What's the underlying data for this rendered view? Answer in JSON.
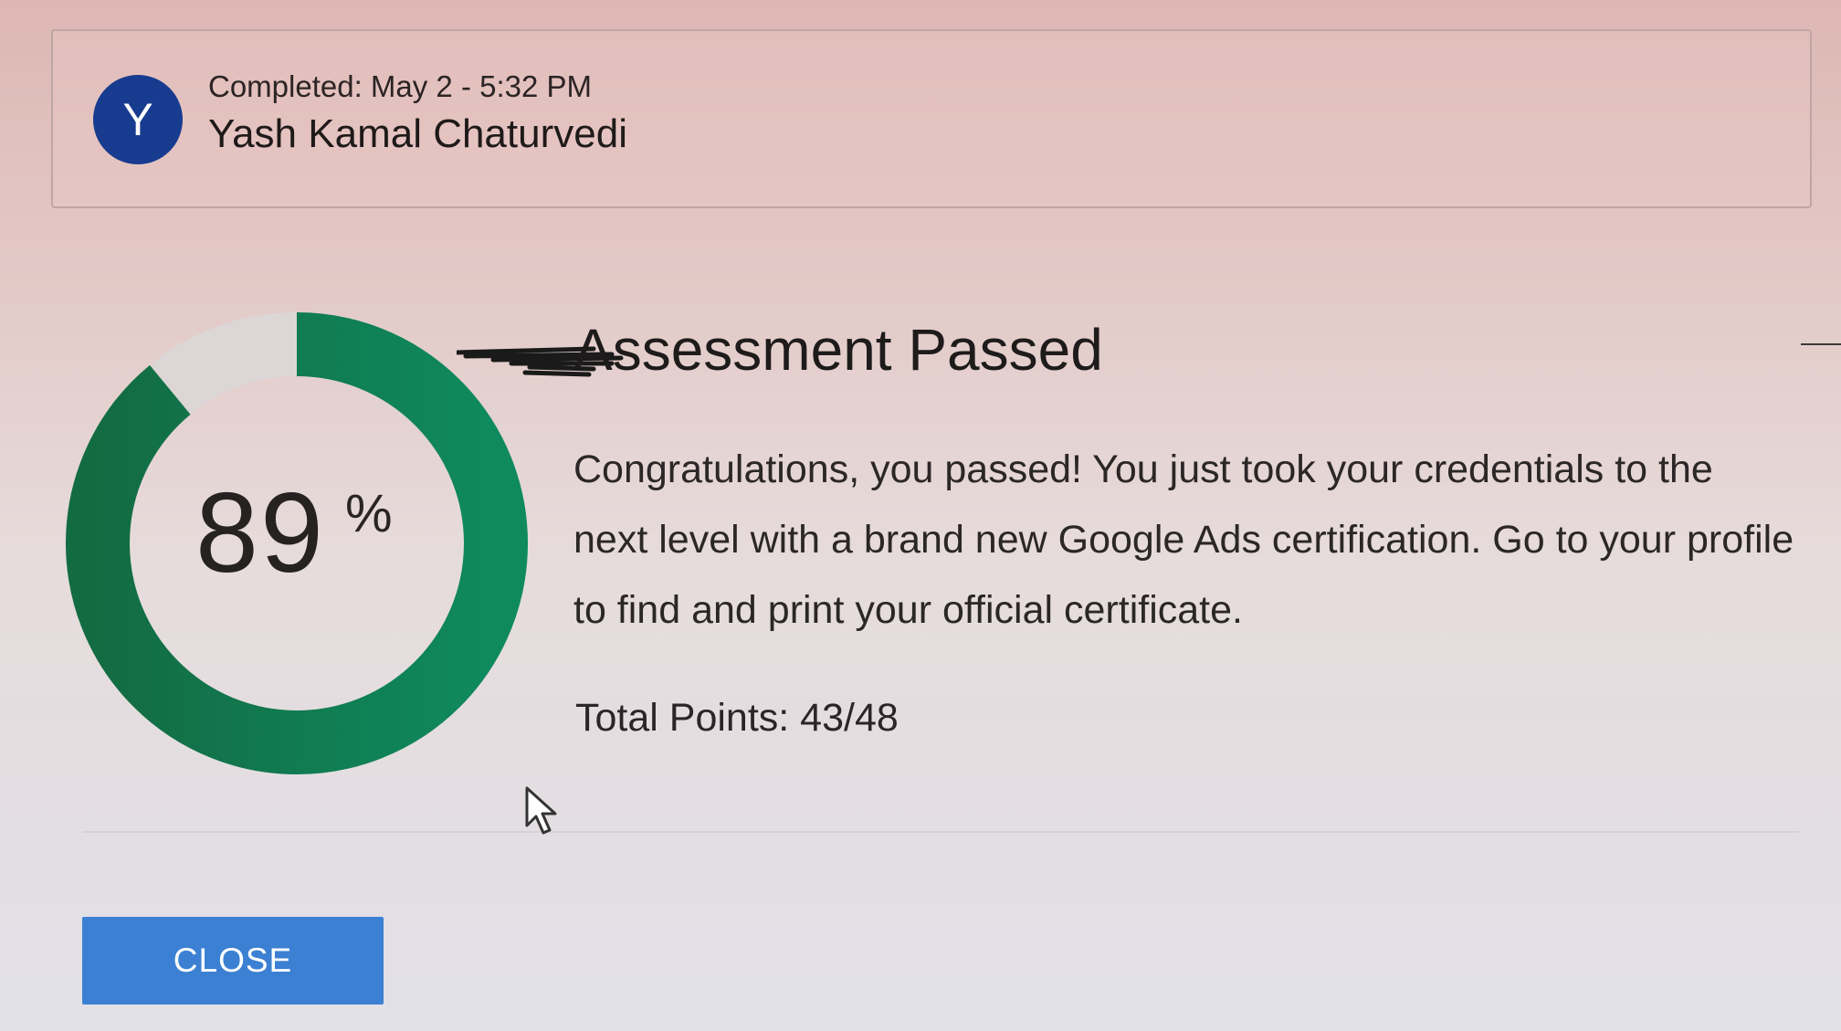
{
  "user": {
    "avatar_letter": "Y",
    "completed": "Completed: May 2 - 5:32 PM",
    "name": "Yash Kamal Chaturvedi"
  },
  "result": {
    "score": "89",
    "score_unit": "%",
    "score_fraction": 0.89,
    "title": "Assessment Passed",
    "message": "Congratulations, you passed! You just took your credentials to the next level with a brand new Google Ads certification. Go to your profile to find and print your official certificate.",
    "total_points": "Total Points: 43/48"
  },
  "actions": {
    "close_label": "CLOSE"
  },
  "colors": {
    "avatar": "#173b8f",
    "gauge_start": "#136b42",
    "gauge_end": "#0f8a5f",
    "gauge_track": "#dcd6d6",
    "button": "#3b80d2"
  }
}
